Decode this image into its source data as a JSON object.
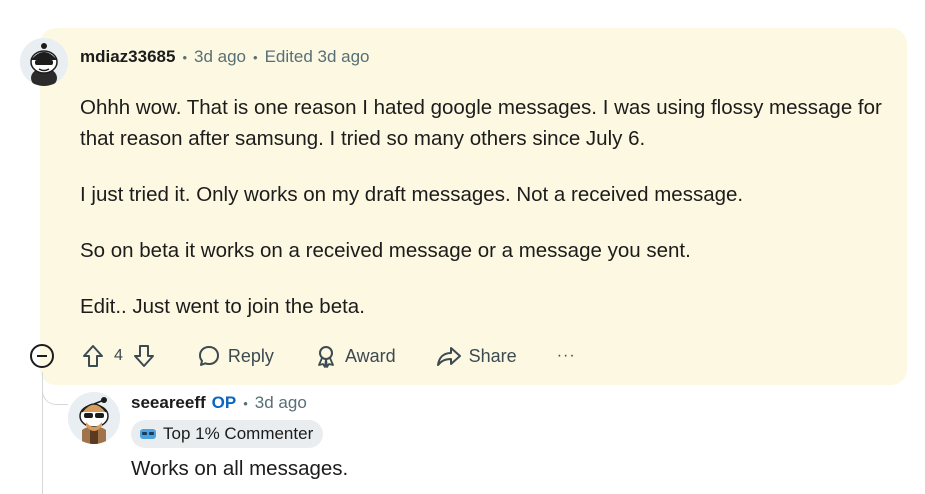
{
  "comment": {
    "username": "mdiaz33685",
    "posted": "3d ago",
    "edited": "Edited 3d ago",
    "paragraphs": [
      "Ohhh wow. That is one reason I hated google messages. I was using flossy message for that reason after samsung. I tried so many others since July 6.",
      "I just tried it. Only works on my draft messages. Not a received message.",
      "So on beta it works on a received message or a message you sent.",
      "Edit.. Just went to join the beta."
    ],
    "vote_count": "4",
    "actions": {
      "reply": "Reply",
      "award": "Award",
      "share": "Share",
      "more": "···"
    }
  },
  "reply": {
    "username": "seeareeff",
    "op_label": "OP",
    "posted": "3d ago",
    "badge": "Top 1% Commenter",
    "body": "Works on all messages."
  },
  "colors": {
    "highlight_bg": "#fdf8e1",
    "op_blue": "#0a66c2",
    "meta_gray": "#576f76",
    "badge_bg": "#eaedef"
  }
}
